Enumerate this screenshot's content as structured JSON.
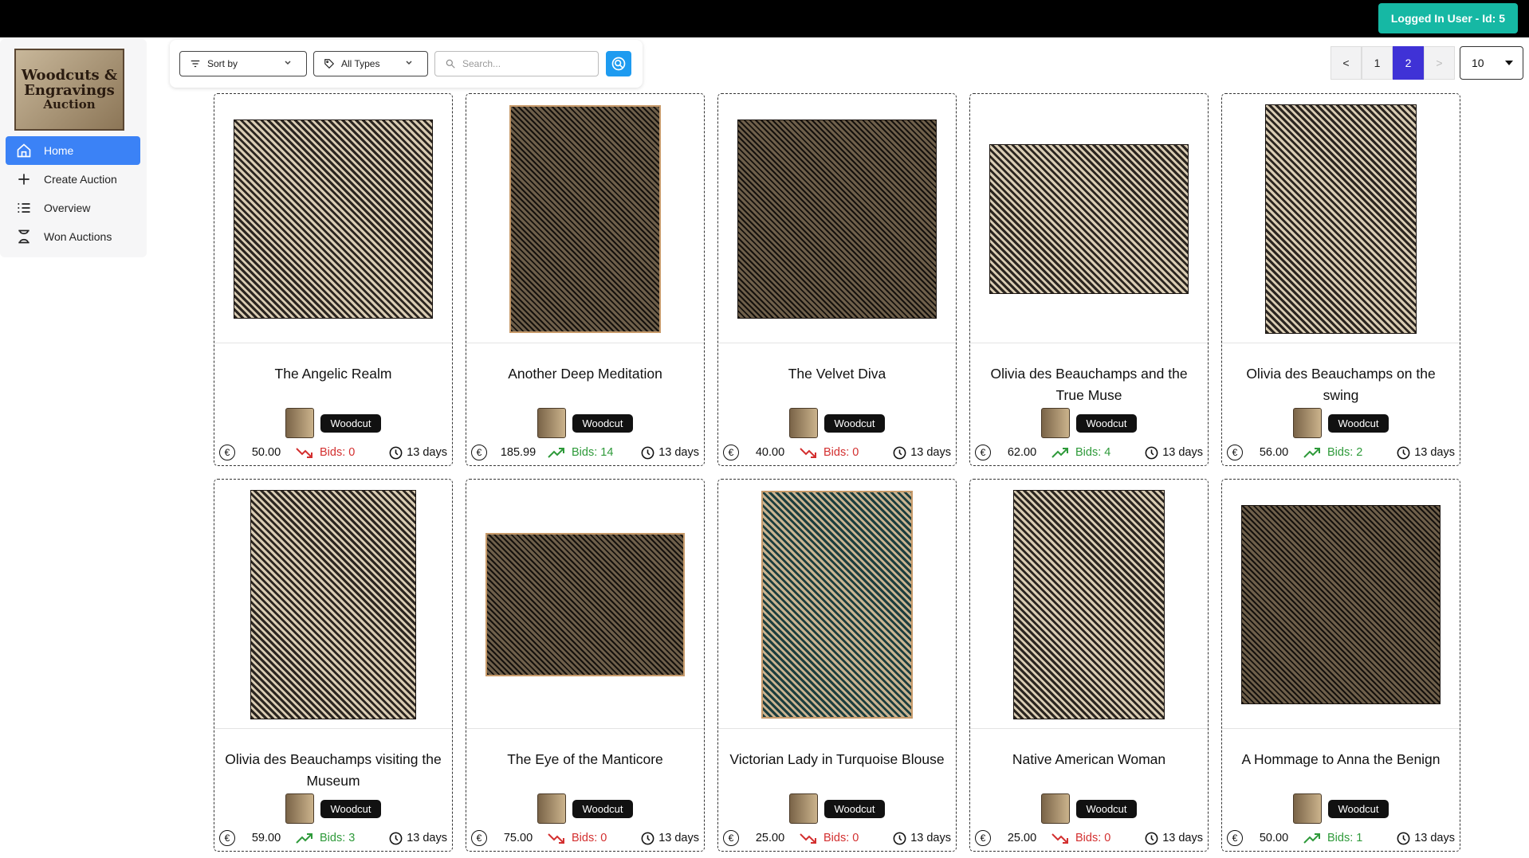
{
  "header": {
    "user_label": "Logged In User - Id: 5"
  },
  "sidebar": {
    "logo": {
      "line1": "Woodcuts &",
      "line2": "Engravings",
      "line3": "Auction"
    },
    "items": [
      {
        "label": "Home",
        "icon": "home-icon",
        "active": true
      },
      {
        "label": "Create Auction",
        "icon": "plus-icon"
      },
      {
        "label": "Overview",
        "icon": "list-icon"
      },
      {
        "label": "Won Auctions",
        "icon": "trophy-icon"
      }
    ]
  },
  "filters": {
    "sort_label": "Sort by",
    "type_label": "All Types",
    "search_placeholder": "Search..."
  },
  "pagination": {
    "prev": "<",
    "pages": [
      "1",
      "2"
    ],
    "current": "2",
    "next": ">",
    "per_page": "10"
  },
  "cards": [
    {
      "title": "The Angelic Realm",
      "type": "Woodcut",
      "price": "50.00",
      "bids": "Bids: 0",
      "trend": "down",
      "time": "13 days"
    },
    {
      "title": "Another Deep Meditation",
      "type": "Woodcut",
      "price": "185.99",
      "bids": "Bids: 14",
      "trend": "up",
      "time": "13 days"
    },
    {
      "title": "The Velvet Diva",
      "type": "Woodcut",
      "price": "40.00",
      "bids": "Bids: 0",
      "trend": "down",
      "time": "13 days"
    },
    {
      "title": "Olivia des Beauchamps and the True Muse",
      "type": "Woodcut",
      "price": "62.00",
      "bids": "Bids: 4",
      "trend": "up",
      "time": "13 days"
    },
    {
      "title": "Olivia des Beauchamps on the swing",
      "type": "Woodcut",
      "price": "56.00",
      "bids": "Bids: 2",
      "trend": "up",
      "time": "13 days"
    },
    {
      "title": "Olivia des Beauchamps visiting the Museum",
      "type": "Woodcut",
      "price": "59.00",
      "bids": "Bids: 3",
      "trend": "up",
      "time": "13 days"
    },
    {
      "title": "The Eye of the Manticore",
      "type": "Woodcut",
      "price": "75.00",
      "bids": "Bids: 0",
      "trend": "down",
      "time": "13 days"
    },
    {
      "title": "Victorian Lady in Turquoise Blouse",
      "type": "Woodcut",
      "price": "25.00",
      "bids": "Bids: 0",
      "trend": "down",
      "time": "13 days"
    },
    {
      "title": "Native American Woman",
      "type": "Woodcut",
      "price": "25.00",
      "bids": "Bids: 0",
      "trend": "down",
      "time": "13 days"
    },
    {
      "title": "A Hommage to Anna the Benign",
      "type": "Woodcut",
      "price": "50.00",
      "bids": "Bids: 1",
      "trend": "up",
      "time": "13 days"
    }
  ]
}
